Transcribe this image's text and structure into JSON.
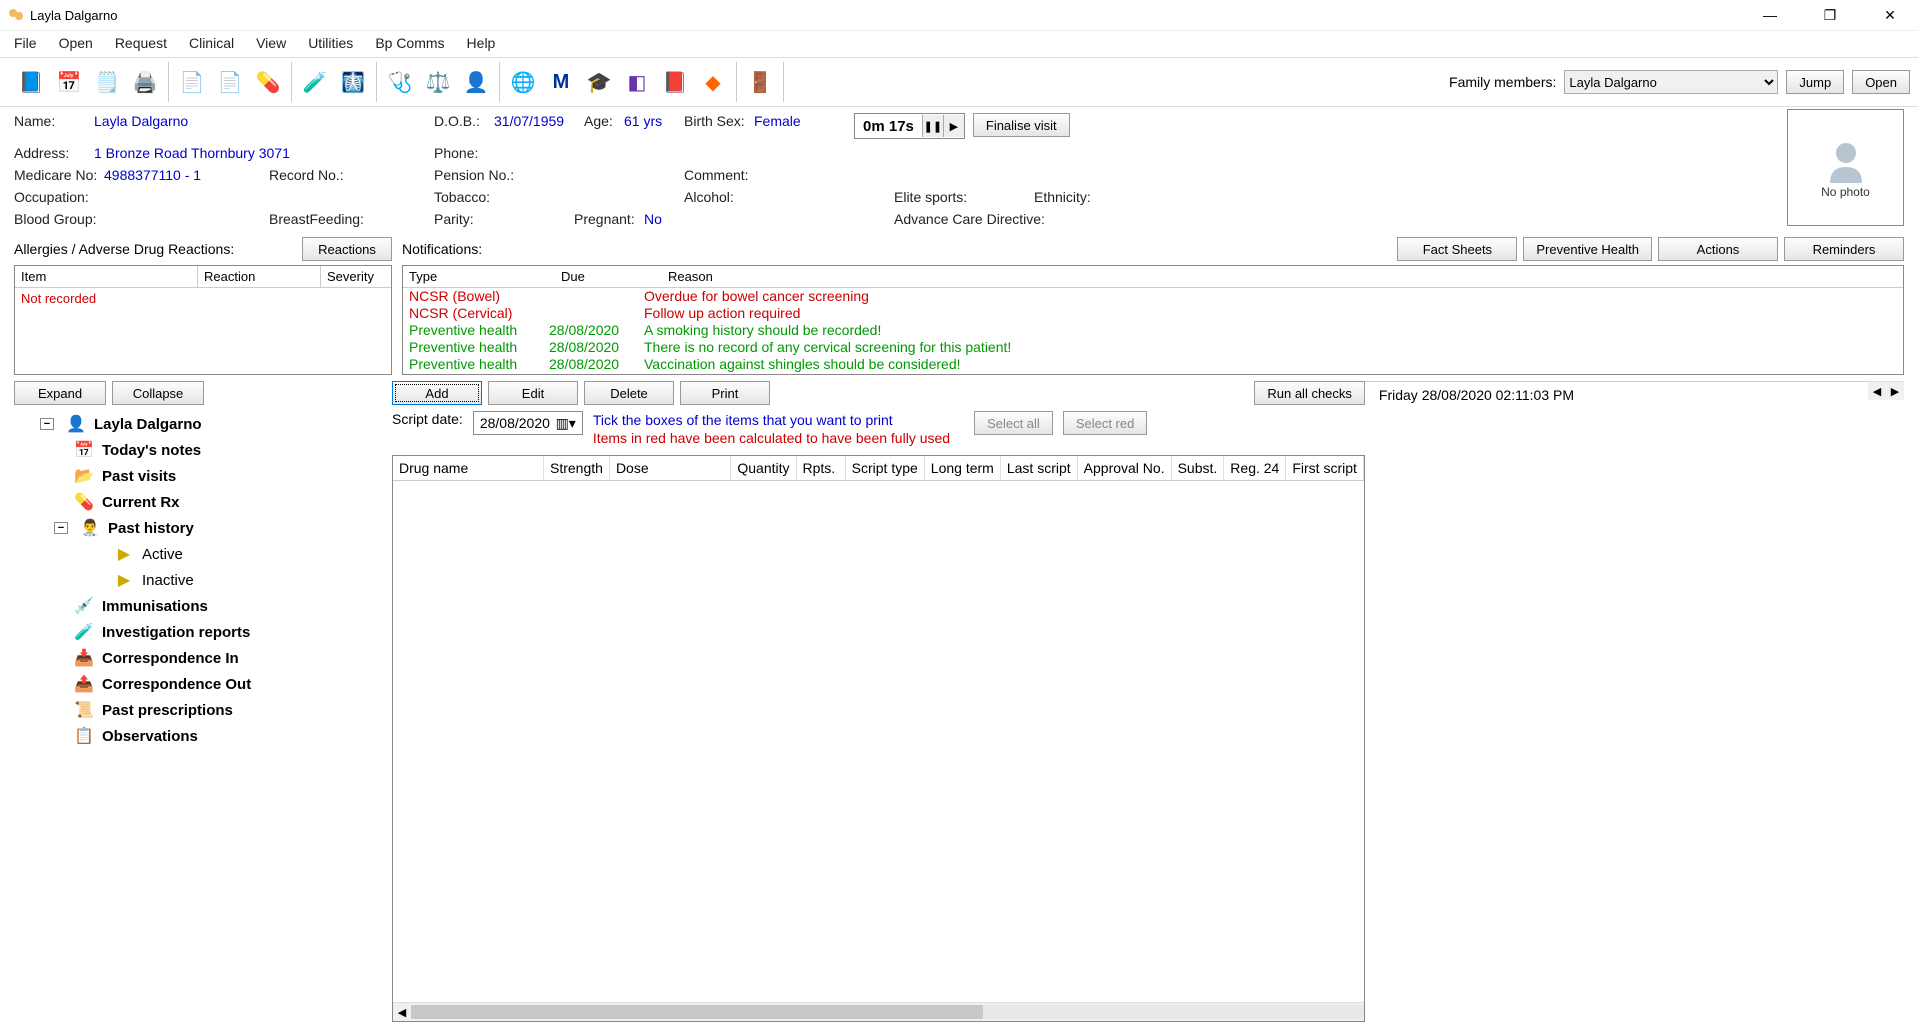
{
  "window": {
    "title": "Layla Dalgarno"
  },
  "menus": [
    "File",
    "Open",
    "Request",
    "Clinical",
    "View",
    "Utilities",
    "Bp Comms",
    "Help"
  ],
  "family": {
    "label": "Family members:",
    "selected": "Layla Dalgarno",
    "jump": "Jump",
    "open": "Open"
  },
  "patient": {
    "name_lbl": "Name:",
    "name": "Layla Dalgarno",
    "dob_lbl": "D.O.B.:",
    "dob": "31/07/1959",
    "age_lbl": "Age:",
    "age": "61 yrs",
    "sex_lbl": "Birth Sex:",
    "sex": "Female",
    "addr_lbl": "Address:",
    "addr": "1 Bronze Road  Thornbury  3071",
    "phone_lbl": "Phone:",
    "medicare_lbl": "Medicare No:",
    "medicare": "4988377110 - 1",
    "record_lbl": "Record No.:",
    "pension_lbl": "Pension No.:",
    "comment_lbl": "Comment:",
    "occupation_lbl": "Occupation:",
    "tobacco_lbl": "Tobacco:",
    "alcohol_lbl": "Alcohol:",
    "elite_lbl": "Elite sports:",
    "ethnicity_lbl": "Ethnicity:",
    "blood_lbl": "Blood Group:",
    "breast_lbl": "BreastFeeding:",
    "parity_lbl": "Parity:",
    "pregnant_lbl": "Pregnant:",
    "pregnant": "No",
    "acd_lbl": "Advance Care Directive:",
    "photo": "No photo",
    "timer": "0m  17s",
    "finalise": "Finalise visit"
  },
  "allergies": {
    "title": "Allergies / Adverse Drug Reactions:",
    "reactions_btn": "Reactions",
    "cols": {
      "item": "Item",
      "reaction": "Reaction",
      "severity": "Severity"
    },
    "not_recorded": "Not recorded"
  },
  "notifications": {
    "title": "Notifications:",
    "btns": {
      "fact": "Fact Sheets",
      "prev": "Preventive Health",
      "actions": "Actions",
      "rem": "Reminders"
    },
    "cols": {
      "type": "Type",
      "due": "Due",
      "reason": "Reason"
    },
    "rows": [
      {
        "type": "NCSR (Bowel)",
        "due": "",
        "reason": "Overdue for bowel cancer screening",
        "cls": "red"
      },
      {
        "type": "NCSR (Cervical)",
        "due": "",
        "reason": "Follow up action required",
        "cls": "red"
      },
      {
        "type": "Preventive health",
        "due": "28/08/2020",
        "reason": "A smoking history should be recorded!",
        "cls": "green"
      },
      {
        "type": "Preventive health",
        "due": "28/08/2020",
        "reason": "There is no record of any cervical screening for this patient!",
        "cls": "green"
      },
      {
        "type": "Preventive health",
        "due": "28/08/2020",
        "reason": "Vaccination against shingles should be considered!",
        "cls": "green"
      }
    ]
  },
  "tree": {
    "expand": "Expand",
    "collapse": "Collapse",
    "root": "Layla Dalgarno",
    "items": [
      "Today's notes",
      "Past visits",
      "Current Rx",
      "Past history",
      "Active",
      "Inactive",
      "Immunisations",
      "Investigation reports",
      "Correspondence In",
      "Correspondence Out",
      "Past prescriptions",
      "Observations"
    ]
  },
  "rx": {
    "btns": {
      "add": "Add",
      "edit": "Edit",
      "delete": "Delete",
      "print": "Print",
      "run": "Run all checks",
      "selall": "Select all",
      "selred": "Select red"
    },
    "script_date_lbl": "Script date:",
    "script_date": "28/08/2020",
    "hint1": "Tick the boxes of the items that you want to print",
    "hint2": "Items in red have been calculated to have been fully used",
    "cols": [
      "Drug name",
      "Strength",
      "Dose",
      "Quantity",
      "Rpts.",
      "Script type",
      "Long term",
      "Last script",
      "Approval No.",
      "Subst.",
      "Reg. 24",
      "First script"
    ]
  },
  "status": {
    "datetime": "Friday 28/08/2020 02:11:03 PM"
  }
}
